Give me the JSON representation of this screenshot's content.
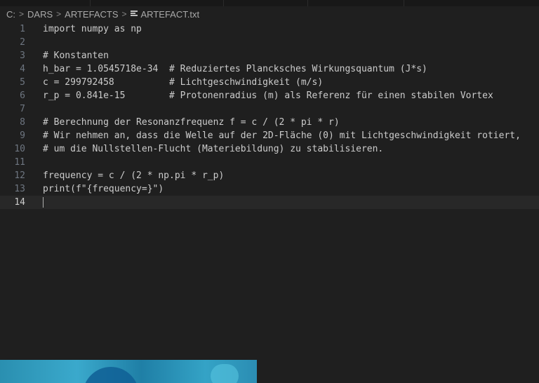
{
  "breadcrumb": {
    "items": [
      "C:",
      "DARS",
      "ARTEFACTS"
    ],
    "separator": ">",
    "file_name": "ARTEFACT.txt",
    "file_icon": "text-file-icon"
  },
  "editor": {
    "current_line": "14",
    "lines": [
      {
        "num": "1",
        "text": "import numpy as np"
      },
      {
        "num": "2",
        "text": ""
      },
      {
        "num": "3",
        "text": "# Konstanten"
      },
      {
        "num": "4",
        "text": "h_bar = 1.0545718e-34  # Reduziertes Plancksches Wirkungsquantum (J*s)"
      },
      {
        "num": "5",
        "text": "c = 299792458          # Lichtgeschwindigkeit (m/s)"
      },
      {
        "num": "6",
        "text": "r_p = 0.841e-15        # Protonenradius (m) als Referenz für einen stabilen Vortex"
      },
      {
        "num": "7",
        "text": ""
      },
      {
        "num": "8",
        "text": "# Berechnung der Resonanzfrequenz f = c / (2 * pi * r)"
      },
      {
        "num": "9",
        "text": "# Wir nehmen an, dass die Welle auf der 2D-Fläche (0) mit Lichtgeschwindigkeit rotiert,"
      },
      {
        "num": "10",
        "text": "# um die Nullstellen-Flucht (Materiebildung) zu stabilisieren."
      },
      {
        "num": "11",
        "text": ""
      },
      {
        "num": "12",
        "text": "frequency = c / (2 * np.pi * r_p)"
      },
      {
        "num": "13",
        "text": "print(f\"{frequency=}\")"
      },
      {
        "num": "14",
        "text": ""
      }
    ]
  },
  "colors": {
    "background": "#1f1f1f",
    "current_line_bg": "#282828",
    "text": "#cccccc",
    "line_number": "#6e7681"
  }
}
